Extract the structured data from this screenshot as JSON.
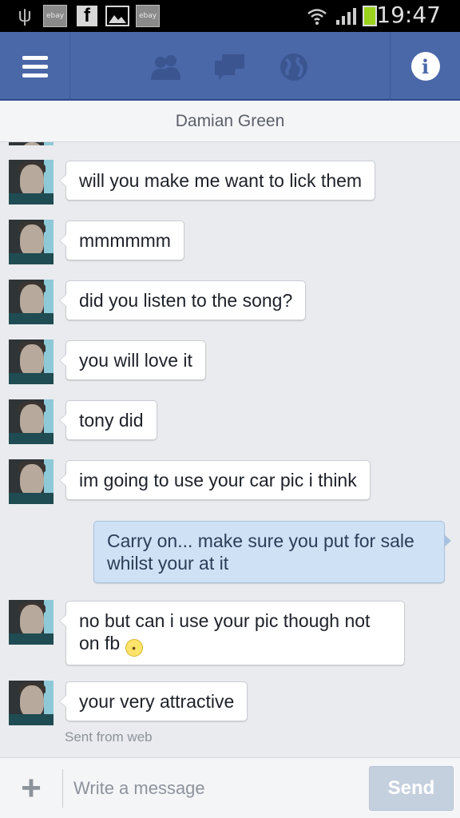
{
  "status_bar": {
    "time": "19:47",
    "ebay_label": "ebay",
    "facebook_glyph": "f",
    "icons": [
      "usb-icon",
      "ebay-icon",
      "facebook-icon",
      "gallery-icon",
      "wifi-icon",
      "signal-icon",
      "battery-charging-icon"
    ]
  },
  "app_bar": {
    "background": "#4a67a8",
    "icons": [
      "menu-icon",
      "friends-icon",
      "messages-icon",
      "globe-icon",
      "info-icon"
    ],
    "info_glyph": "i"
  },
  "conversation": {
    "title": "Damian Green"
  },
  "messages": [
    {
      "from": "other",
      "text": "will you make me want to lick them"
    },
    {
      "from": "other",
      "text": "mmmmmm"
    },
    {
      "from": "other",
      "text": "did you listen to the song?"
    },
    {
      "from": "other",
      "text": "you will love it"
    },
    {
      "from": "other",
      "text": "tony did"
    },
    {
      "from": "other",
      "text": "im going to use your car pic i think"
    },
    {
      "from": "me",
      "text": "Carry on... make sure you put for sale whilst your at it"
    },
    {
      "from": "other",
      "text": "no but can i use your pic though not on fb",
      "emoji": "wink-emoji"
    },
    {
      "from": "other",
      "text": "your very attractive"
    }
  ],
  "sent_from": "Sent from web",
  "composer": {
    "placeholder": "Write a message",
    "add_glyph": "+",
    "send_label": "Send"
  },
  "colors": {
    "incoming_bubble": "#ffffff",
    "outgoing_bubble": "#cfe1f5",
    "send_button_disabled": "#c5d0df"
  }
}
